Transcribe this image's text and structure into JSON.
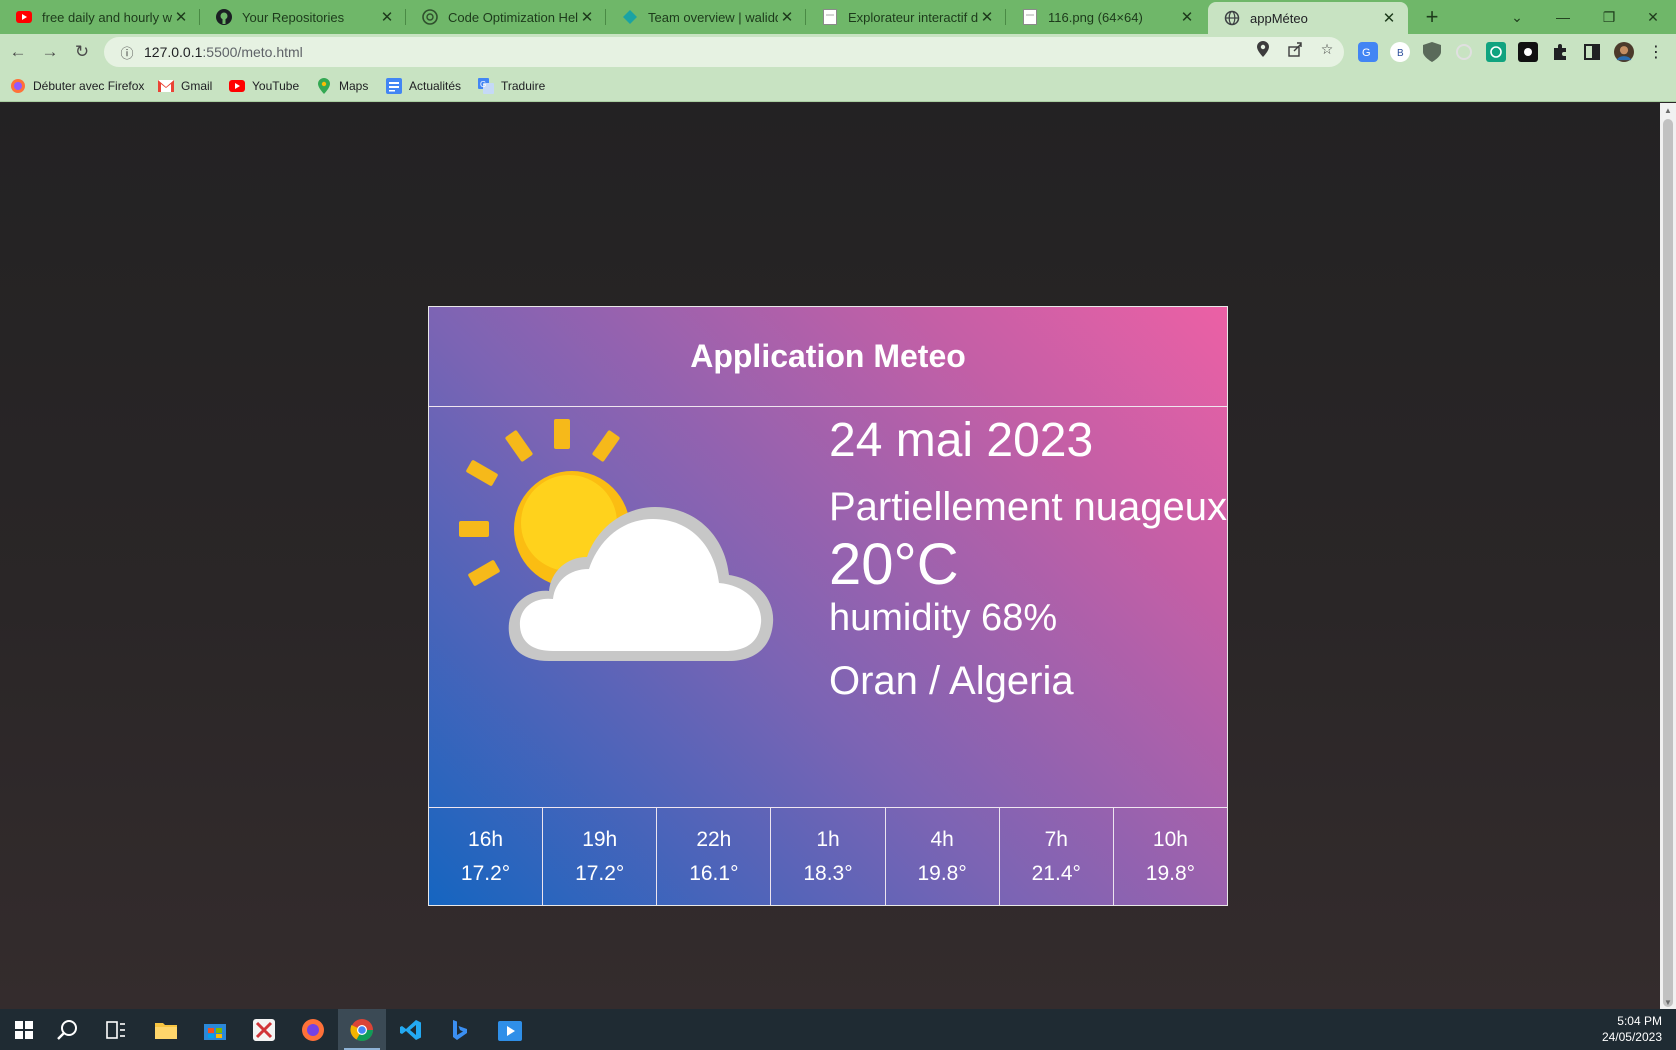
{
  "browser": {
    "tabs": [
      {
        "title": "free daily and hourly wea",
        "icon": "youtube-icon"
      },
      {
        "title": "Your Repositories",
        "icon": "github-icon"
      },
      {
        "title": "Code Optimization Help",
        "icon": "chatgpt-icon"
      },
      {
        "title": "Team overview | waliddjla",
        "icon": "team-icon"
      },
      {
        "title": "Explorateur interactif de l",
        "icon": "page-icon"
      },
      {
        "title": "116.png (64×64)",
        "icon": "image-icon"
      },
      {
        "title": "appMéteo",
        "icon": "globe-icon"
      }
    ],
    "url_host": "127.0.0.1",
    "url_rest": ":5500/meto.html",
    "bookmarks": [
      {
        "label": "Débuter avec Firefox",
        "icon": "firefox-icon"
      },
      {
        "label": "Gmail",
        "icon": "gmail-icon"
      },
      {
        "label": "YouTube",
        "icon": "youtube-icon"
      },
      {
        "label": "Maps",
        "icon": "maps-icon"
      },
      {
        "label": "Actualités",
        "icon": "news-icon"
      },
      {
        "label": "Traduire",
        "icon": "translate-icon"
      }
    ]
  },
  "app": {
    "title": "Application Meteo",
    "date": "24 mai 2023",
    "description": "Partiellement nuageux",
    "temperature": "20°C",
    "humidity": "humidity 68%",
    "location": "Oran / Algeria",
    "icon": "partly-cloudy-icon",
    "forecast": [
      {
        "hour": "16h",
        "temp": "17.2°"
      },
      {
        "hour": "19h",
        "temp": "17.2°"
      },
      {
        "hour": "22h",
        "temp": "16.1°"
      },
      {
        "hour": "1h",
        "temp": "18.3°"
      },
      {
        "hour": "4h",
        "temp": "19.8°"
      },
      {
        "hour": "7h",
        "temp": "21.4°"
      },
      {
        "hour": "10h",
        "temp": "19.8°"
      }
    ]
  },
  "taskbar": {
    "time": "5:04 PM",
    "date": "24/05/2023"
  },
  "colors": {
    "browser_frame": "#6fb769",
    "toolbar": "#c8e3c2",
    "card_gradient_start": "#1565c0",
    "card_gradient_end": "#ec60a5"
  }
}
